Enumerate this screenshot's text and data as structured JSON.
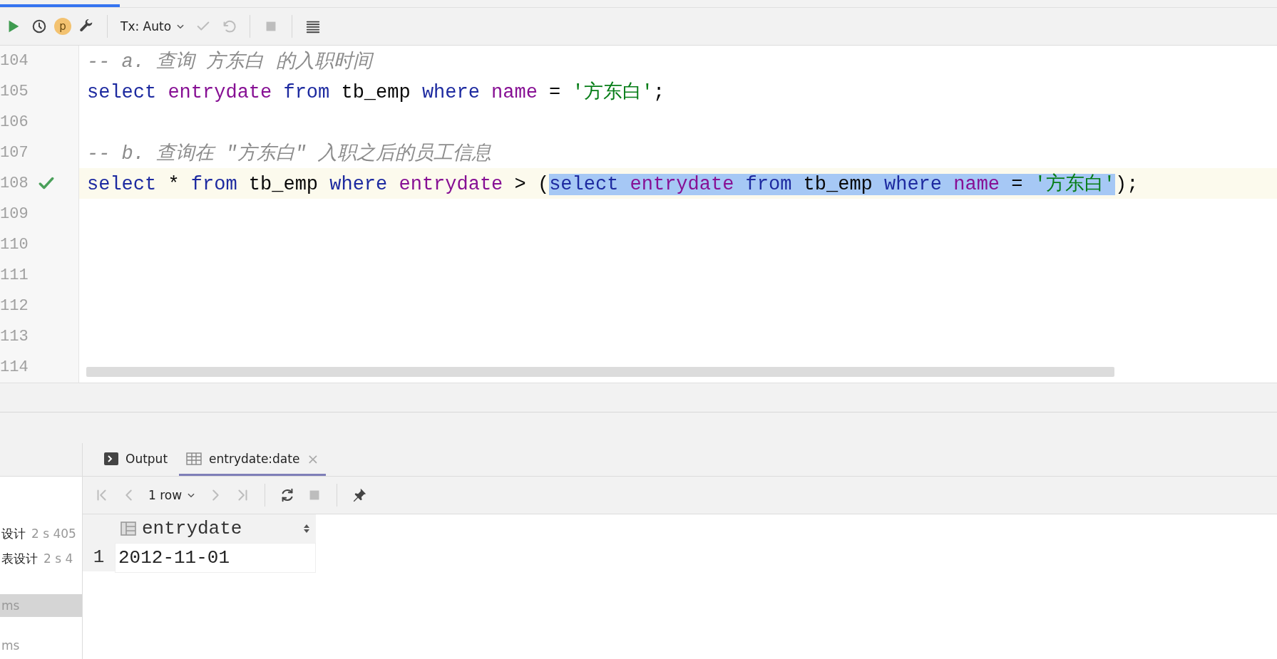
{
  "toolbar": {
    "items": [
      {
        "kind": "run",
        "disabled": false
      },
      {
        "kind": "history",
        "disabled": false
      },
      {
        "kind": "profile",
        "label": "p",
        "disabled": false
      },
      {
        "kind": "settings",
        "disabled": false
      },
      {
        "kind": "separator"
      },
      {
        "kind": "tx",
        "label": "Tx: Auto",
        "disabled": false
      },
      {
        "kind": "commit",
        "disabled": true
      },
      {
        "kind": "rollback",
        "disabled": true
      },
      {
        "kind": "separator"
      },
      {
        "kind": "stop",
        "disabled": true
      },
      {
        "kind": "separator"
      },
      {
        "kind": "layout",
        "disabled": false
      }
    ]
  },
  "editor": {
    "lines": [
      {
        "number": "104",
        "current": false,
        "check": false,
        "tokens": [
          {
            "kind": "comment",
            "text": "-- a. 查询 方东白 的入职时间",
            "selected": false
          }
        ]
      },
      {
        "number": "105",
        "current": false,
        "check": false,
        "tokens": [
          {
            "kind": "keyword",
            "text": "select ",
            "selected": false
          },
          {
            "kind": "ident",
            "text": "entrydate ",
            "selected": false
          },
          {
            "kind": "keyword",
            "text": "from",
            "selected": false
          },
          {
            "kind": "plain",
            "text": " tb_emp ",
            "selected": false
          },
          {
            "kind": "keyword",
            "text": "where ",
            "selected": false
          },
          {
            "kind": "ident",
            "text": "name",
            "selected": false
          },
          {
            "kind": "plain",
            "text": " = ",
            "selected": false
          },
          {
            "kind": "string",
            "text": "'方东白'",
            "selected": false
          },
          {
            "kind": "plain",
            "text": ";",
            "selected": false
          }
        ]
      },
      {
        "number": "106",
        "current": false,
        "check": false
      },
      {
        "number": "107",
        "current": false,
        "check": false,
        "tokens": [
          {
            "kind": "comment",
            "text": "-- b. 查询在 \"方东白\" 入职之后的员工信息",
            "selected": false
          }
        ]
      },
      {
        "number": "108",
        "current": true,
        "check": true,
        "tokens": [
          {
            "kind": "keyword",
            "text": "select",
            "selected": false
          },
          {
            "kind": "plain",
            "text": " * ",
            "selected": false
          },
          {
            "kind": "keyword",
            "text": "from",
            "selected": false
          },
          {
            "kind": "plain",
            "text": " tb_emp ",
            "selected": false
          },
          {
            "kind": "keyword",
            "text": "where ",
            "selected": false
          },
          {
            "kind": "ident",
            "text": "entrydate",
            "selected": false
          },
          {
            "kind": "plain",
            "text": " > (",
            "selected": false
          },
          {
            "kind": "keyword",
            "text": "select ",
            "selected": true
          },
          {
            "kind": "ident",
            "text": "entrydate ",
            "selected": true
          },
          {
            "kind": "keyword",
            "text": "from",
            "selected": true
          },
          {
            "kind": "plain",
            "text": " tb_emp ",
            "selected": true
          },
          {
            "kind": "keyword",
            "text": "where ",
            "selected": true
          },
          {
            "kind": "ident",
            "text": "name",
            "selected": true
          },
          {
            "kind": "plain",
            "text": " = ",
            "selected": true
          },
          {
            "kind": "string",
            "text": "'方东白'",
            "selected": true
          },
          {
            "kind": "plain",
            "text": ");",
            "selected": false
          }
        ]
      },
      {
        "number": "109",
        "current": false,
        "check": false
      },
      {
        "number": "110",
        "current": false,
        "check": false
      },
      {
        "number": "111",
        "current": false,
        "check": false
      },
      {
        "number": "112",
        "current": false,
        "check": false
      },
      {
        "number": "113",
        "current": false,
        "check": false
      },
      {
        "number": "114",
        "current": false,
        "check": false
      }
    ]
  },
  "services": {
    "items": [
      {
        "name": "设计",
        "time": "2 s 405",
        "selected": false
      },
      {
        "name": "表设计",
        "time": "2 s 4",
        "selected": false
      },
      {
        "time": "ms",
        "selected": true
      },
      {
        "time": "ms",
        "selected": false
      }
    ]
  },
  "results": {
    "tabs": [
      {
        "kind": "output",
        "label": "Output",
        "selected": false
      },
      {
        "kind": "table",
        "label": "entrydate:date",
        "close": "×",
        "selected": true
      }
    ],
    "toolbar": [
      {
        "kind": "first",
        "disabled": true
      },
      {
        "kind": "prev",
        "disabled": true
      },
      {
        "kind": "rows",
        "label": "1 row",
        "disabled": false
      },
      {
        "kind": "next",
        "disabled": true
      },
      {
        "kind": "last",
        "disabled": true
      },
      {
        "kind": "separator"
      },
      {
        "kind": "refresh",
        "disabled": false
      },
      {
        "kind": "stop",
        "disabled": true
      },
      {
        "kind": "separator"
      },
      {
        "kind": "pin",
        "disabled": false
      }
    ],
    "table": {
      "columns": [
        "entrydate"
      ],
      "rows": [
        {
          "number": "1",
          "cells": [
            "2012-11-01"
          ]
        }
      ]
    }
  }
}
